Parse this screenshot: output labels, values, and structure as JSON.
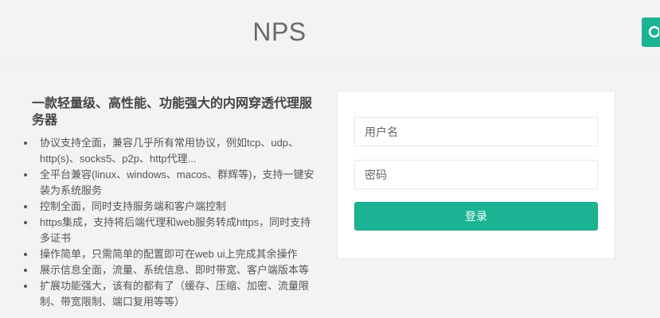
{
  "header": {
    "brand": "NPS"
  },
  "intro": {
    "title": "一款轻量级、高性能、功能强大的内网穿透代理服务器",
    "features": [
      "协议支持全面，兼容几乎所有常用协议，例如tcp、udp、http(s)、socks5、p2p、http代理...",
      "全平台兼容(linux、windows、macos、群辉等)，支持一键安装为系统服务",
      "控制全面，同时支持服务端和客户端控制",
      "https集成，支持将后端代理和web服务转成https，同时支持多证书",
      "操作简单，只需简单的配置即可在web ui上完成其余操作",
      "展示信息全面，流量、系统信息、即时带宽、客户端版本等",
      "扩展功能强大，该有的都有了（缓存、压缩、加密、流量限制、带宽限制、端口复用等等）"
    ]
  },
  "login": {
    "username_placeholder": "用户名",
    "password_placeholder": "密码",
    "submit_label": "登录"
  },
  "colors": {
    "accent": "#1ab394",
    "background": "#f3f3f4"
  }
}
